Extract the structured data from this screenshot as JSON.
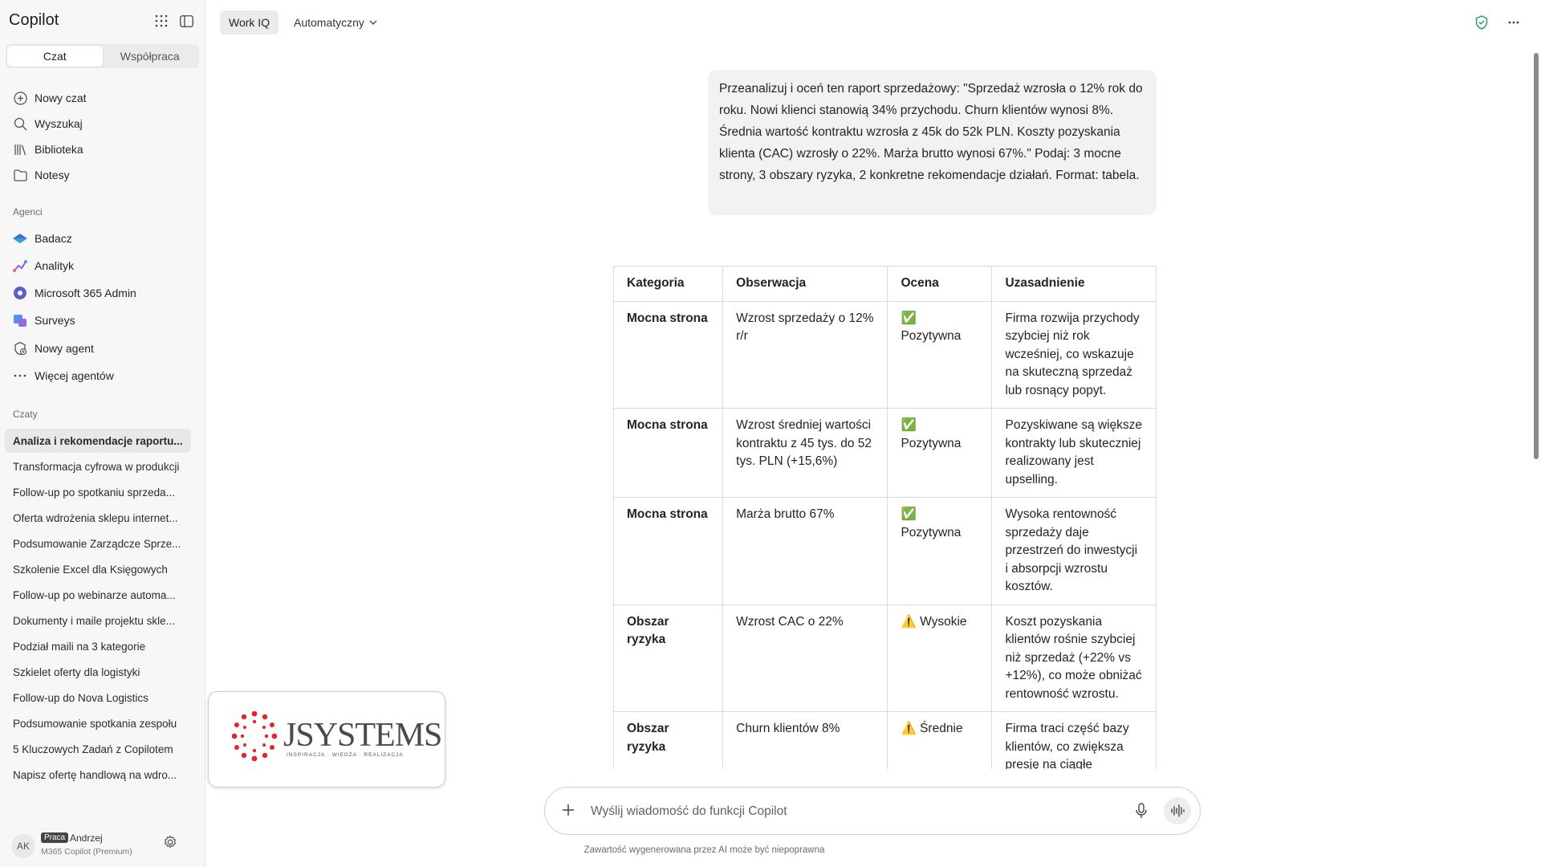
{
  "app": {
    "title": "Copilot"
  },
  "sidebar": {
    "mode_tabs": [
      "Czat",
      "Współpraca"
    ],
    "nav": [
      {
        "label": "Nowy czat",
        "icon": "plus-circle-icon"
      },
      {
        "label": "Wyszukaj",
        "icon": "search-icon"
      },
      {
        "label": "Biblioteka",
        "icon": "library-icon"
      },
      {
        "label": "Notesy",
        "icon": "folder-icon"
      }
    ],
    "agents_label": "Agenci",
    "agents": [
      {
        "label": "Badacz",
        "icon": "researcher-icon"
      },
      {
        "label": "Analityk",
        "icon": "analyst-icon"
      },
      {
        "label": "Microsoft 365 Admin",
        "icon": "admin-gear-icon"
      },
      {
        "label": "Surveys",
        "icon": "surveys-icon"
      },
      {
        "label": "Nowy agent",
        "icon": "new-agent-icon"
      },
      {
        "label": "Więcej agentów",
        "icon": "more-dots-icon"
      }
    ],
    "chats_label": "Czaty",
    "chats": [
      "Analiza i rekomendacje raportu...",
      "Transformacja cyfrowa w produkcji",
      "Follow-up po spotkaniu sprzeda...",
      "Oferta wdrożenia sklepu internet...",
      "Podsumowanie Zarządcze Sprze...",
      "Szkolenie Excel dla Księgowych",
      "Follow-up po webinarze automa...",
      "Dokumenty i maile projektu skle...",
      "Podział maili na 3 kategorie",
      "Szkielet oferty dla logistyki",
      "Follow-up do Nova Logistics",
      "Podsumowanie spotkania zespołu",
      "5 Kluczowych Zadań z Copilotem",
      "Napisz ofertę handlową na wdro..."
    ],
    "user": {
      "initials": "AK",
      "badge": "Praca",
      "name": "Andrzej",
      "plan": "M365 Copilot (Premium)"
    }
  },
  "topbar": {
    "work_iq": "Work IQ",
    "mode": "Automatyczny"
  },
  "message": {
    "text": "Przeanalizuj i oceń ten raport sprzedażowy: \"Sprzedaż wzrosła o 12% rok do roku. Nowi klienci stanowią 34% przychodu. Churn klientów wynosi 8%. Średnia wartość kontraktu wzrosła z 45k do 52k PLN. Koszty pozyskania klienta (CAC) wzrosły o 22%. Marża brutto wynosi 67%.\" Podaj: 3 mocne strony, 3 obszary ryzyka, 2 konkretne rekomendacje działań. Format: tabela."
  },
  "table": {
    "headers": [
      "Kategoria",
      "Obserwacja",
      "Ocena",
      "Uzasadnienie"
    ],
    "rows": [
      [
        "Mocna strona",
        "Wzrost sprzedaży o 12% r/r",
        "✅ Pozytywna",
        "Firma rozwija przychody szybciej niż rok wcześniej, co wskazuje na skuteczną sprzedaż lub rosnący popyt."
      ],
      [
        "Mocna strona",
        "Wzrost średniej wartości kontraktu z 45 tys. do 52 tys. PLN (+15,6%)",
        "✅ Pozytywna",
        "Pozyskiwane są większe kontrakty lub skuteczniej realizowany jest upselling."
      ],
      [
        "Mocna strona",
        "Marża brutto 67%",
        "✅ Pozytywna",
        "Wysoka rentowność sprzedaży daje przestrzeń do inwestycji i absorpcji wzrostu kosztów."
      ],
      [
        "Obszar ryzyka",
        "Wzrost CAC o 22%",
        "⚠️ Wysokie",
        "Koszt pozyskania klientów rośnie szybciej niż sprzedaż (+22% vs +12%), co może obniżać rentowność wzrostu."
      ],
      [
        "Obszar ryzyka",
        "Churn klientów 8%",
        "⚠️ Średnie",
        "Firma traci część bazy klientów, co zwiększa presję na ciągłe pozyskiwanie nowych."
      ]
    ]
  },
  "logo": {
    "word": "JSYSTEMS",
    "tagline": "INSPIRACJA · WIEDZA · REALIZACJA"
  },
  "composer": {
    "placeholder": "Wyślij wiadomość do funkcji Copilot"
  },
  "footer": {
    "disclaimer": "Zawartość wygenerowana przez AI może być niepoprawna"
  }
}
